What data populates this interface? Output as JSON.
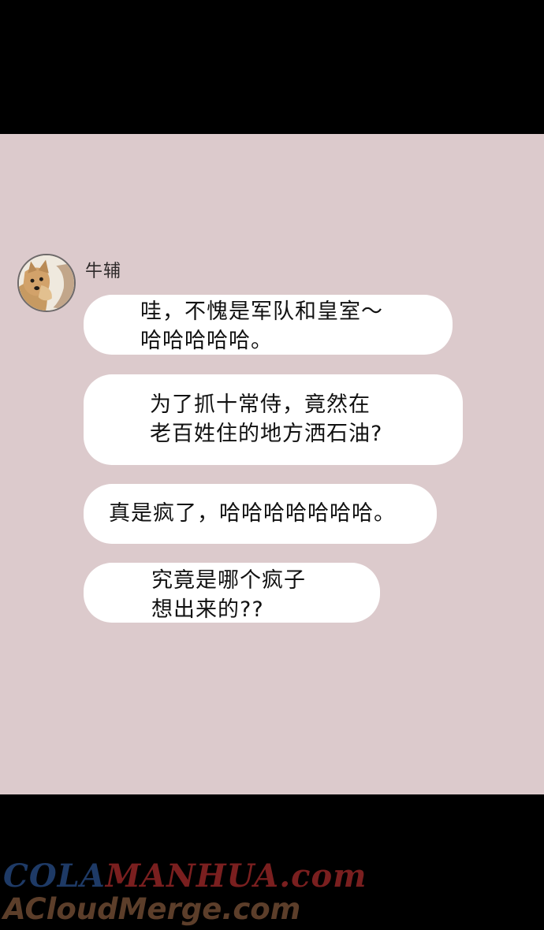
{
  "chat": {
    "sender_name": "牛辅",
    "avatar_icon": "yorkshire-terrier-avatar",
    "messages": [
      {
        "lines": [
          "哇，不愧是军队和皇室～",
          "哈哈哈哈哈。"
        ]
      },
      {
        "lines": [
          "为了抓十常侍，竟然在",
          "老百姓住的地方洒石油?"
        ]
      },
      {
        "lines": [
          "真是疯了，哈哈哈哈哈哈哈。"
        ]
      },
      {
        "lines": [
          "究竟是哪个疯子",
          "想出来的??"
        ]
      }
    ]
  },
  "watermark": {
    "line1_part1": "COLA",
    "line1_part2": "MANHUA.com",
    "line2": "ACloudMerge.com"
  },
  "colors": {
    "background": "#000000",
    "panel": "#dccacc",
    "bubble": "#ffffff"
  }
}
